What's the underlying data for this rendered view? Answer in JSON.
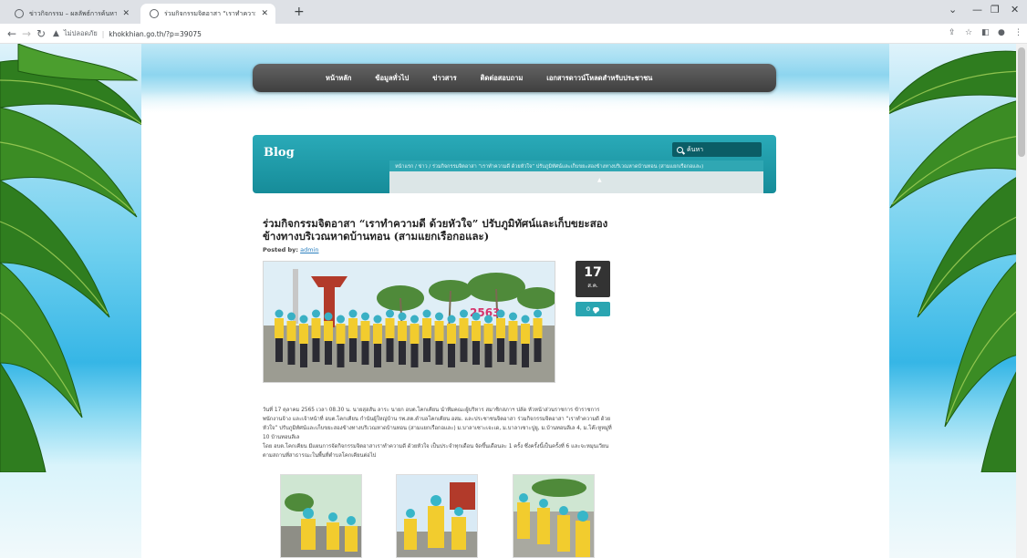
{
  "browser": {
    "tabs": [
      {
        "title": "ข่าวกิจกรรม – ผลลัพธ์การค้นหา"
      },
      {
        "title": "ร่วมกิจกรรมจิตอาสา “เราทำความดี ด้วย"
      }
    ],
    "address": {
      "security_label": "ไม่ปลอดภัย",
      "url": "khokkhian.go.th/?p=39075"
    }
  },
  "nav": {
    "items": [
      "หน้าหลัก",
      "ข้อมูลทั่วไป",
      "ข่าวสาร",
      "ติดต่อสอบถาม",
      "เอกสารดาวน์โหลดสำหรับประชาชน"
    ]
  },
  "blog": {
    "title": "Blog",
    "search_placeholder": "ค้นหา",
    "breadcrumb": "หน้าแรก  /  ข่าว  /  ร่วมกิจกรรมจิตอาสา “เราทำความดี ด้วยหัวใจ” ปรับภูมิทัศน์และเก็บขยะสองข้างทางบริเวณหาดบ้านทอน (สามแยกเรือกอและ)"
  },
  "post": {
    "title": "ร่วมกิจกรรมจิตอาสา “เราทำความดี ด้วยหัวใจ” ปรับภูมิทัศน์และเก็บขยะสองข้างทางบริเวณหาดบ้านทอน (สามแยกเรือกอและ)",
    "posted_by_label": "Posted by:",
    "author": "admin",
    "date_day": "17",
    "date_month": "ส.ค.",
    "comment_count": "0",
    "body_p1": "วันที่ 17 ตุลาคม 2565 เวลา 08.30 น. นายสุฮสัน ลาระ นายก อบต.โคกเคียน นำทีมคณะผู้บริหาร สมาชิกสภาฯ ปลัด หัวหน้าส่วนราชการ ข้าราชการ พนักงานจ้าง และเจ้าหน้าที่ อบต.โคกเคียน กำนันผู้ใหญ่บ้าน รพ.สต.ตำบลโคกเคียน อสม. และประชาชนจิตอาสา ร่วมกิจกรรมจิตอาสา “เราทำความดี ด้วยหัวใจ” ปรับภูมิทัศน์และเก็บขยะสองข้างทางบริเวณหาดบ้านทอน (สามแยกเรือกอและ) ม.บาลาเซาะเจะเด, ม.บาลาเซาะปูยู, ม.บ้านทอนลีเล 4, ม.โค๊ะหูหมู่ที่ 10 บ้านทอนลีเล",
    "body_p2": "โดย อบต.โคกเคียน มีแผนการจัดกิจกรรมจิตอาสาเราทำความดี ด้วยหัวใจ เป็นประจำทุกเดือน จัดขึ้นเดือนละ 1 ครั้ง ซึ่งครั้งนี้เป็นครั้งที่ 6 และจะหมุนเวียนตามสถานที่สาธารณะในพื้นที่ตำบลโคกเคียนต่อไป"
  },
  "colors": {
    "nav_bg": "#4a4a4a",
    "blog_bar": "#1f9eab",
    "date_box": "#333333",
    "comment_btn": "#2aa5b1",
    "link": "#2a7fbf"
  },
  "icons": [
    "globe-tab-icon",
    "close-tab-icon",
    "new-tab-icon",
    "back-icon",
    "forward-icon",
    "reload-icon",
    "warning-icon",
    "share-icon",
    "star-icon",
    "sidepanel-icon",
    "profile-icon",
    "menu-icon",
    "search-icon",
    "comment-icon"
  ]
}
